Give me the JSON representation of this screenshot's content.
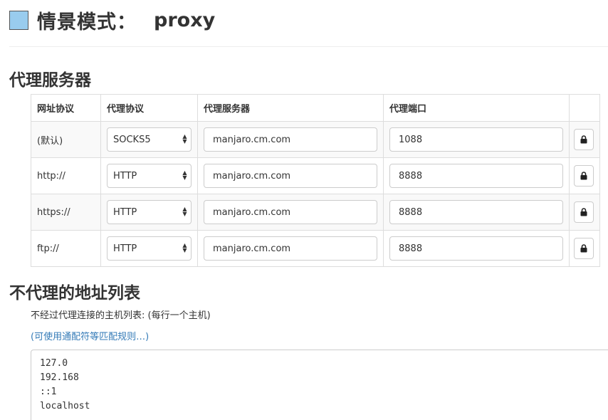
{
  "header": {
    "title": "情景模式：",
    "profile_name": "proxy",
    "profile_color": "#99ccee"
  },
  "proxy_section": {
    "title": "代理服务器",
    "columns": [
      "网址协议",
      "代理协议",
      "代理服务器",
      "代理端口"
    ],
    "rows": [
      {
        "scheme": "(默认)",
        "protocol": "SOCKS5",
        "server": "manjaro.cm.com",
        "port": "1088",
        "icon": "lock-icon"
      },
      {
        "scheme": "http://",
        "protocol": "HTTP",
        "server": "manjaro.cm.com",
        "port": "8888",
        "icon": "lock-icon"
      },
      {
        "scheme": "https://",
        "protocol": "HTTP",
        "server": "manjaro.cm.com",
        "port": "8888",
        "icon": "lock-icon"
      },
      {
        "scheme": "ftp://",
        "protocol": "HTTP",
        "server": "manjaro.cm.com",
        "port": "8888",
        "icon": "lock-icon"
      }
    ]
  },
  "bypass_section": {
    "title": "不代理的地址列表",
    "description": "不经过代理连接的主机列表: (每行一个主机)",
    "link": "(可使用通配符等匹配规则…)",
    "entries": [
      "127.0",
      "192.168",
      "::1",
      "localhost"
    ]
  },
  "colors": {
    "link": "#337ab7",
    "border": "#dddddd",
    "stripe": "#f9f9f9"
  }
}
